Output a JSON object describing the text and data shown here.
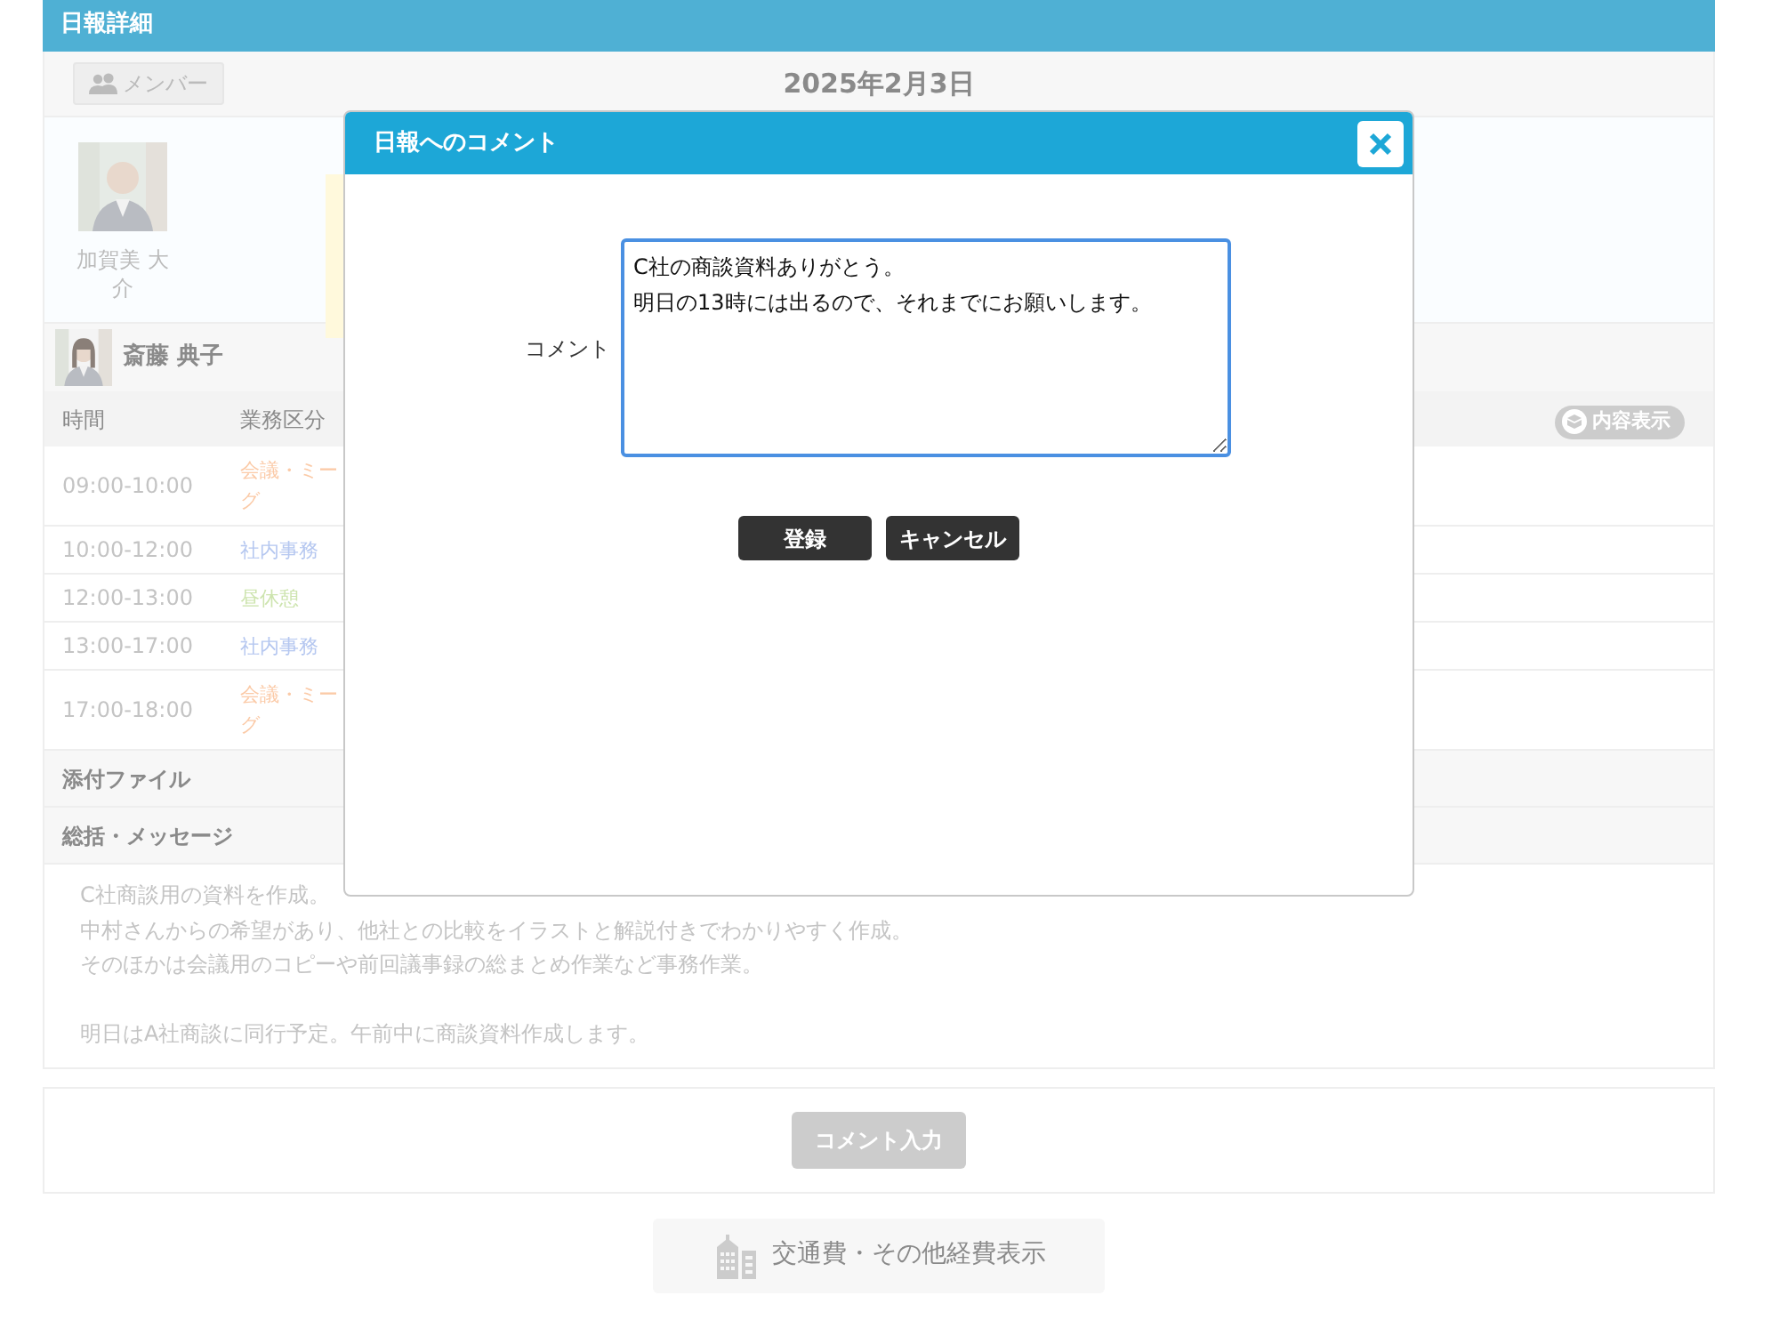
{
  "page_header": {
    "title": "日報詳細"
  },
  "toolbar": {
    "member_button": "メンバー",
    "date": "2025年2月3日"
  },
  "members": [
    {
      "name": "加賀美 大介"
    }
  ],
  "report": {
    "person": "斎藤 典子",
    "columns": [
      "時間",
      "業務区分"
    ],
    "view_button": "内容表示",
    "rows": [
      {
        "time": "09:00-10:00",
        "category": [
          "会議・ミー",
          "グ"
        ],
        "color": "#fbcaa7"
      },
      {
        "time": "10:00-12:00",
        "category": [
          "社内事務"
        ],
        "color": "#b5c7f0"
      },
      {
        "time": "12:00-13:00",
        "category": [
          "昼休憩"
        ],
        "color": "#cde4ae"
      },
      {
        "time": "13:00-17:00",
        "category": [
          "社内事務"
        ],
        "color": "#b5c7f0"
      },
      {
        "time": "17:00-18:00",
        "category": [
          "会議・ミー",
          "グ"
        ],
        "color": "#fbcaa7"
      }
    ]
  },
  "attachments_label": "添付ファイル",
  "summary_label": "総括・メッセージ",
  "summary": [
    [
      "C社商談用の資料を作成。",
      "中村さんからの希望があり、他社との比較をイラストと解説付きでわかりやすく作成。",
      "そのほかは会議用のコピーや前回議事録の総まとめ作業など事務作業。"
    ],
    [
      "明日はA社商談に同行予定。午前中に商談資料作成します。"
    ]
  ],
  "comment_button": "コメント入力",
  "expense_button": "交通費・その他経費表示",
  "modal": {
    "title": "日報へのコメント",
    "field_label": "コメント",
    "value_lines": [
      "C社の商談資料ありがとう。",
      "明日の13時には出るので、それまでにお願いします。"
    ],
    "buttons": [
      "登録",
      "キャンセル"
    ]
  }
}
